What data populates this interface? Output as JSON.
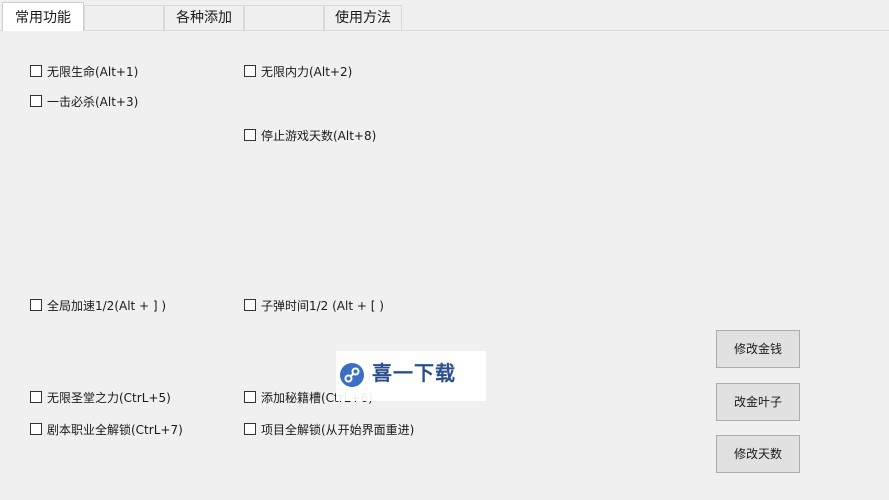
{
  "tabs": [
    {
      "label": "常用功能"
    },
    {
      "label": ""
    },
    {
      "label": "各种添加"
    },
    {
      "label": ""
    },
    {
      "label": "使用方法"
    }
  ],
  "checkboxes": {
    "infinite_life": "无限生命(Alt+1)",
    "infinite_power": "无限内力(Alt+2)",
    "one_hit_kill": "一击必杀(Alt+3)",
    "stop_days": "停止游戏天数(Alt+8)",
    "global_speed": "全局加速1/2(Alt + ] )",
    "bullet_time": "子弹时间1/2 (Alt + [ )",
    "infinite_holy": "无限圣堂之力(CtrL+5)",
    "add_slot": "添加秘籍槽(CtrL+6)",
    "unlock_jobs": "剧本职业全解锁(CtrL+7)",
    "unlock_items": "项目全解锁(从开始界面重进)"
  },
  "buttons": {
    "money": "修改金钱",
    "leaves": "改金叶子",
    "days": "修改天数"
  },
  "watermark": {
    "text": "喜一下载",
    "icon": "link-logo-icon",
    "color": "#2b4f8c"
  }
}
